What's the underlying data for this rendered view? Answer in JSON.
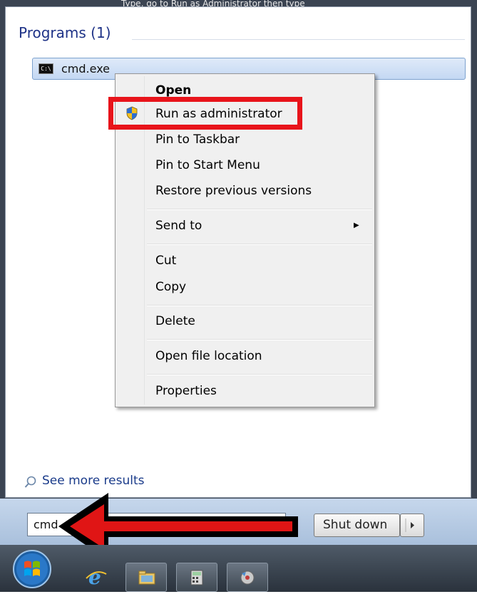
{
  "top_caption": "Type, go to Run as Administrator then type",
  "programs": {
    "header": "Programs (1)",
    "items": [
      {
        "label": "cmd.exe",
        "icon": "cmd-icon"
      }
    ]
  },
  "context_menu": {
    "items": [
      {
        "label": "Open",
        "bold": true
      },
      {
        "label": "Run as administrator",
        "icon": "uac-shield-icon",
        "highlighted": true
      },
      {
        "label": "Pin to Taskbar"
      },
      {
        "label": "Pin to Start Menu"
      },
      {
        "label": "Restore previous versions"
      },
      {
        "label": "Send to",
        "has_submenu": true
      },
      {
        "label": "Cut"
      },
      {
        "label": "Copy"
      },
      {
        "label": "Delete"
      },
      {
        "label": "Open file location"
      },
      {
        "label": "Properties"
      }
    ]
  },
  "see_more": {
    "label": "See more results",
    "icon": "search-icon"
  },
  "search": {
    "value": "cmd"
  },
  "shutdown": {
    "label": "Shut down",
    "icon": "chevron-right-icon"
  },
  "taskbar": {
    "icons": [
      "start-orb-icon",
      "internet-explorer-icon",
      "folder-icon",
      "calculator-icon",
      "media-player-icon"
    ]
  },
  "colors": {
    "highlight_annotation": "#e8141b",
    "arrow_annotation": "#000000",
    "selection": "#c4d8f3"
  }
}
